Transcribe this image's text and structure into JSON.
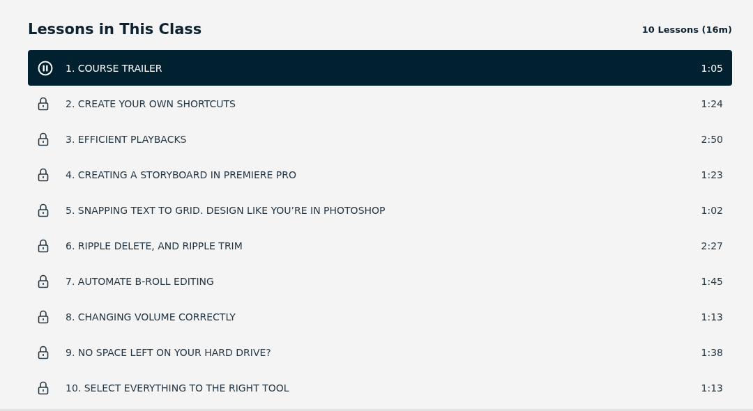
{
  "header": {
    "title": "Lessons in This Class",
    "summary": "10 Lessons (16m)"
  },
  "lessons": [
    {
      "title": "1. COURSE TRAILER",
      "duration": "1:05",
      "kind": "playing",
      "selected": true
    },
    {
      "title": "2. CREATE YOUR OWN SHORTCUTS",
      "duration": "1:24",
      "kind": "locked",
      "selected": false
    },
    {
      "title": "3. EFFICIENT PLAYBACKS",
      "duration": "2:50",
      "kind": "locked",
      "selected": false
    },
    {
      "title": "4. CREATING A STORYBOARD IN PREMIERE PRO",
      "duration": "1:23",
      "kind": "locked",
      "selected": false
    },
    {
      "title": "5. SNAPPING TEXT TO GRID. DESIGN LIKE YOU’RE IN PHOTOSHOP",
      "duration": "1:02",
      "kind": "locked",
      "selected": false
    },
    {
      "title": "6. RIPPLE DELETE, AND RIPPLE TRIM",
      "duration": "2:27",
      "kind": "locked",
      "selected": false
    },
    {
      "title": "7. AUTOMATE B-ROLL EDITING",
      "duration": "1:45",
      "kind": "locked",
      "selected": false
    },
    {
      "title": "8. CHANGING VOLUME CORRECTLY",
      "duration": "1:13",
      "kind": "locked",
      "selected": false
    },
    {
      "title": "9. NO SPACE LEFT ON YOUR HARD DRIVE?",
      "duration": "1:38",
      "kind": "locked",
      "selected": false
    },
    {
      "title": "10. SELECT EVERYTHING TO THE RIGHT TOOL",
      "duration": "1:13",
      "kind": "locked",
      "selected": false
    }
  ]
}
